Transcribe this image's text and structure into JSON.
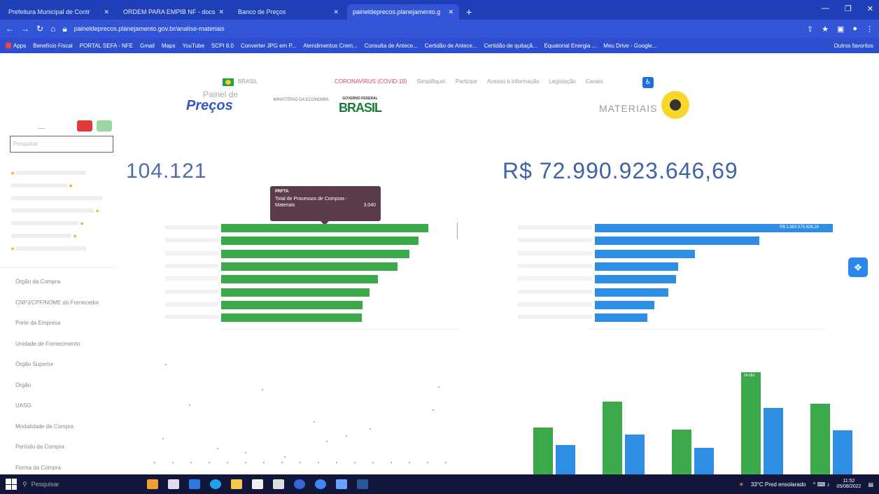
{
  "browser": {
    "tabs": [
      {
        "title": "Prefeitura Municipal de Contr",
        "active": false
      },
      {
        "title": "ORDEM PARA EMPIB NF - docs",
        "active": false
      },
      {
        "title": "Banco de Preços",
        "active": false
      },
      {
        "title": "paineldeprecos.planejamento.g",
        "active": true
      }
    ],
    "url": "paineldeprecos.planejamento.gov.br/analise-materiais",
    "bookmarks": [
      "Apps",
      "Benefício Fiscal",
      "PORTAL SEFA - NFE",
      "Gmail",
      "Maps",
      "YouTube",
      "SCPI 8.0",
      "Converter JPG em P...",
      "Atendimentos Crem...",
      "Consulta de Antece...",
      "Certidão de Antece...",
      "Certidão de quitaçã...",
      "Equatorial Energia ...",
      "Meu Drive - Google..."
    ],
    "bookmarks_right": "Outros favoritos"
  },
  "govbar": {
    "brasil": "BRASIL",
    "links": [
      "CORONAVÍRUS (COVID-19)",
      "Simplifique!",
      "Participe",
      "Acesso à informação",
      "Legislação",
      "Canais"
    ]
  },
  "header": {
    "logo_small": "Painel de",
    "logo_big": "Preços",
    "ministry": "MINISTÉRIO DA ECONOMIA",
    "gov_logo": "BRASIL",
    "gov_logo_small": "GOVERNO FEDERAL",
    "section": "MATERIAIS"
  },
  "sidebar": {
    "search_placeholder": "Pesquisar",
    "items": [
      "Órgão da Compra",
      "CNPJ/CPF/NOME do Fornecedor",
      "Porte da Empresa",
      "Unidade de Fornecimento",
      "Órgão Superior",
      "Órgão",
      "UASG",
      "Modalidade da Compra",
      "Período da Compra",
      "Forma da Compra"
    ]
  },
  "kpis": {
    "total_compras": "104.121",
    "valor_total": "R$ 72.990.923.646,69"
  },
  "tooltip": {
    "header": "PRFTA",
    "label": "Total de Processos de Compras - Materiais",
    "value": "3.040"
  },
  "chart_left": {
    "type": "bar",
    "orientation": "horizontal",
    "values": [
      3040,
      2900,
      2760,
      2590,
      2300,
      2180,
      2070,
      2060
    ],
    "color": "#3ba94a"
  },
  "chart_right": {
    "type": "bar",
    "orientation": "horizontal",
    "values": [
      1.0,
      0.69,
      0.42,
      0.35,
      0.34,
      0.31,
      0.25,
      0.22
    ],
    "first_label": "R$ 1.983.575.826,28",
    "color": "#2d8ee3"
  },
  "chart_bottom_right": {
    "type": "bar",
    "green": [
      0.46,
      0.71,
      0.44,
      1.0,
      0.69
    ],
    "blue": [
      0.29,
      0.39,
      0.26,
      0.65,
      0.43
    ],
    "top_label": "24.063"
  },
  "taskbar": {
    "search": "Pesquisar",
    "weather": "33°C Pred ensolarado",
    "time": "11:52",
    "date": "05/08/2022"
  }
}
